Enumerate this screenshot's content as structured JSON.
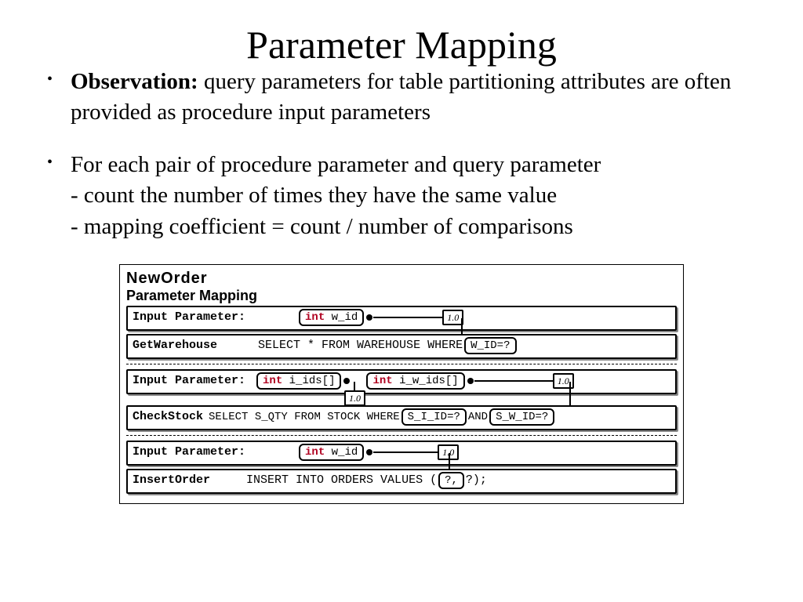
{
  "title": "Parameter Mapping",
  "bullet1": {
    "label": "Observation:",
    "text": " query parameters for table partitioning attributes are often provided as procedure input parameters"
  },
  "bullet2": {
    "line1": "For each pair of procedure parameter and query parameter",
    "line2": "- count the number of times they have the same value",
    "line3": "- mapping coefficient = count / number of comparisons"
  },
  "diagram": {
    "proc": "NewOrder",
    "subtitle": "Parameter Mapping",
    "int": "int",
    "sec1": {
      "input_label": "Input Parameter:",
      "param": "w_id",
      "coef": "1.0",
      "query_label": "GetWarehouse",
      "query_pre": "SELECT * FROM WAREHOUSE WHERE ",
      "query_box": "W_ID=?"
    },
    "sec2": {
      "input_label": "Input Parameter:",
      "p1": "i_ids[]",
      "p2": "i_w_ids[]",
      "coef1": "1.0",
      "coef2": "1.0",
      "query_label": "CheckStock",
      "query_pre": "SELECT S_QTY FROM STOCK WHERE ",
      "qb1": "S_I_ID=?",
      "and": " AND ",
      "qb2": "S_W_ID=?"
    },
    "sec3": {
      "input_label": "Input Parameter:",
      "param": "w_id",
      "coef": "1.0",
      "query_label": "InsertOrder",
      "query_pre": "INSERT INTO ORDERS VALUES (",
      "qb": "?,",
      "query_post": " ?);"
    }
  }
}
